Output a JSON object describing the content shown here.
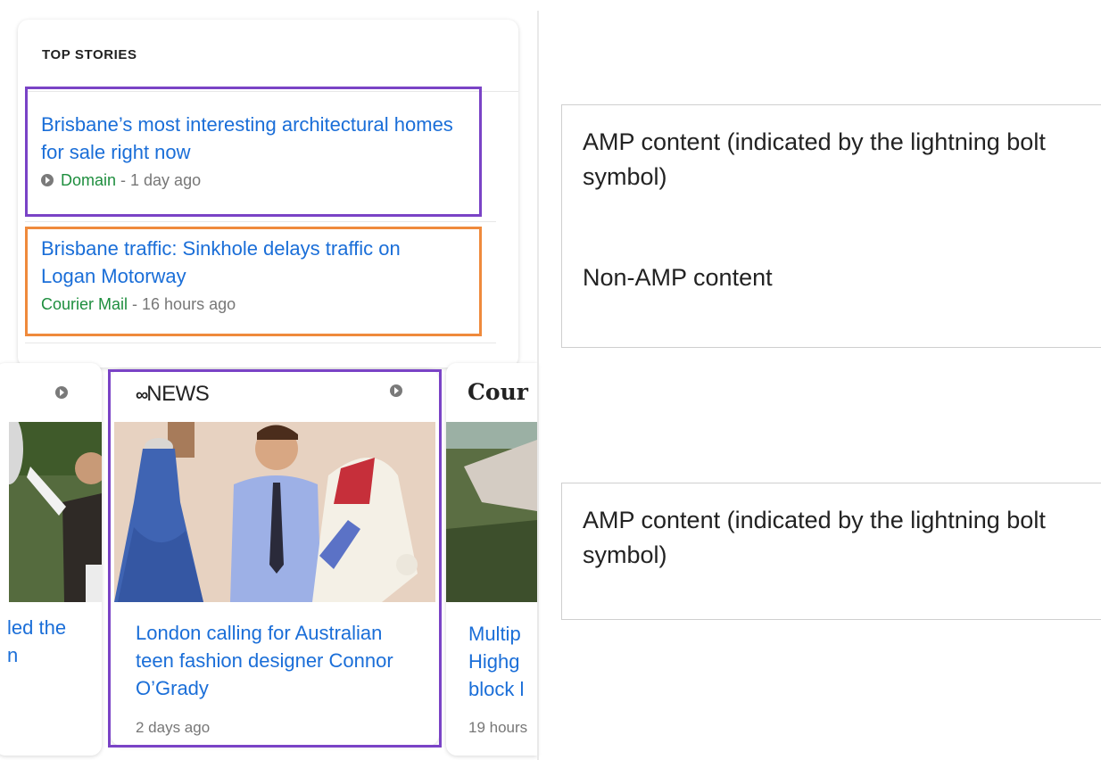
{
  "top_stories": {
    "heading": "TOP STORIES",
    "stories": [
      {
        "title": "Brisbane’s most interesting architectural homes for sale right now",
        "source": "Domain",
        "time": " - 1 day ago",
        "amp": true
      },
      {
        "title": "Brisbane traffic: Sinkhole delays traffic on Logan Motorway",
        "source": "Courier Mail",
        "time": " - 16 hours ago",
        "amp": false
      }
    ]
  },
  "carousel": {
    "cards": [
      {
        "title_fragment": "led the\nn",
        "amp": true
      },
      {
        "logo": "NEWS",
        "title": "London calling for Australian teen fashion designer Connor O’Grady",
        "time": "2 days ago",
        "amp": true
      },
      {
        "logo": "Cour",
        "title_fragment": "Multip\nHighg\nblock l",
        "time": "19 hours"
      }
    ]
  },
  "annotations": {
    "amp_1": "AMP content (indicated by the lightning bolt symbol)",
    "non_amp": "Non-AMP content",
    "amp_2": "AMP content (indicated by the lightning bolt symbol)"
  },
  "colors": {
    "amp_box": "#7a43c6",
    "non_amp_box": "#ef8a3c",
    "link": "#1a6ed8",
    "source": "#1e8e3e"
  }
}
